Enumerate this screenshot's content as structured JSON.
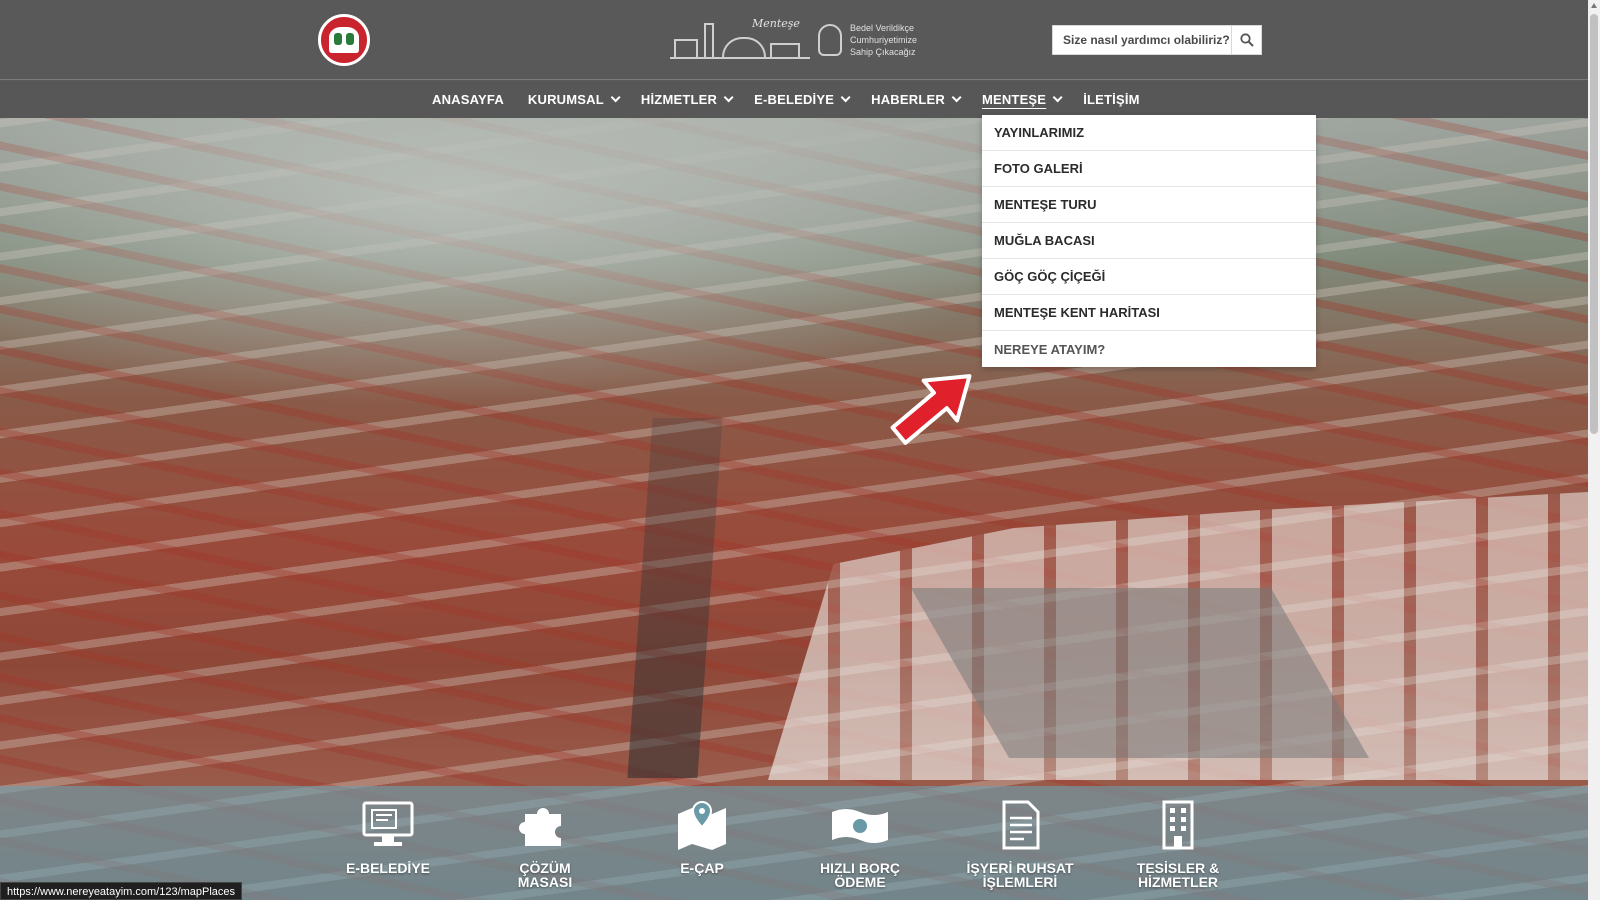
{
  "header": {
    "search_placeholder": "Size nasıl yardımcı olabiliriz?",
    "emblem_script": "Menteşe",
    "motto_lines": [
      "Bedel Verildikçe",
      "Cumhuriyetimize",
      "Sahip Çıkacağız"
    ]
  },
  "nav": {
    "items": [
      {
        "label": "ANASAYFA",
        "has_dropdown": false
      },
      {
        "label": "KURUMSAL",
        "has_dropdown": true
      },
      {
        "label": "HİZMETLER",
        "has_dropdown": true
      },
      {
        "label": "E-BELEDİYE",
        "has_dropdown": true
      },
      {
        "label": "HABERLER",
        "has_dropdown": true
      },
      {
        "label": "MENTEŞE",
        "has_dropdown": true,
        "active": true
      },
      {
        "label": "İLETİŞİM",
        "has_dropdown": false
      }
    ]
  },
  "dropdown": {
    "items": [
      "YAYINLARIMIZ",
      "FOTO GALERİ",
      "MENTEŞE TURU",
      "MUĞLA BACASI",
      "GÖÇ GÖÇ ÇİÇEĞİ",
      "MENTEŞE KENT HARİTASI",
      "NEREYE ATAYIM?"
    ]
  },
  "quick_links": [
    {
      "label_lines": [
        "E-BELEDİYE"
      ],
      "icon": "computer-icon"
    },
    {
      "label_lines": [
        "ÇÖZÜM",
        "MASASI"
      ],
      "icon": "puzzle-icon"
    },
    {
      "label_lines": [
        "E-ÇAP"
      ],
      "icon": "map-pin-icon"
    },
    {
      "label_lines": [
        "HIZLI BORÇ",
        "ÖDEME"
      ],
      "icon": "banknote-icon"
    },
    {
      "label_lines": [
        "İŞYERİ RUHSAT",
        "İŞLEMLERİ"
      ],
      "icon": "document-icon"
    },
    {
      "label_lines": [
        "TESİSLER &",
        "HİZMETLER"
      ],
      "icon": "building-icon"
    }
  ],
  "status_url": "https://www.nereyeatayim.com/123/mapPlaces",
  "colors": {
    "header_bg": "#595959",
    "accent_red": "#e0202a",
    "quickbar_tint": "#6ea0af"
  }
}
